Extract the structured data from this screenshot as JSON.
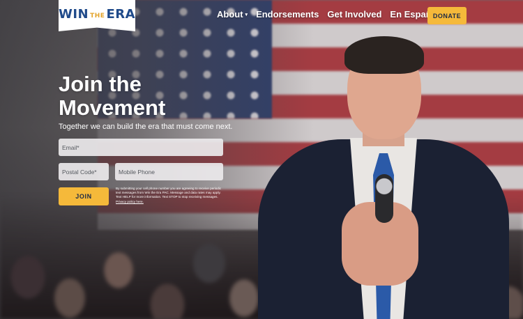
{
  "logo": {
    "part1": "WIN",
    "part2": "THE",
    "part3": "ERA"
  },
  "nav": {
    "items": [
      {
        "label": "About",
        "caret": "▾"
      },
      {
        "label": "Endorsements"
      },
      {
        "label": "Get Involved"
      },
      {
        "label": "En Español"
      }
    ],
    "donate_label": "DONATE"
  },
  "hero": {
    "title": "Join the Movement",
    "subtitle": "Together we can build the era that must come next."
  },
  "form": {
    "email_placeholder": "Email*",
    "postal_placeholder": "Postal Code*",
    "mobile_placeholder": "Mobile Phone",
    "join_label": "JOIN",
    "disclaimer": "By submitting your cell phone number you are agreeing to receive periodic text messages from Win the Era PAC. Message and data rates may apply. Text HELP for more information. Text STOP to stop receiving messages.",
    "privacy_link": "Privacy policy here."
  },
  "colors": {
    "accent": "#f5b93a",
    "brand_blue": "#1f4a8a",
    "text_dark": "#1d2a45"
  }
}
